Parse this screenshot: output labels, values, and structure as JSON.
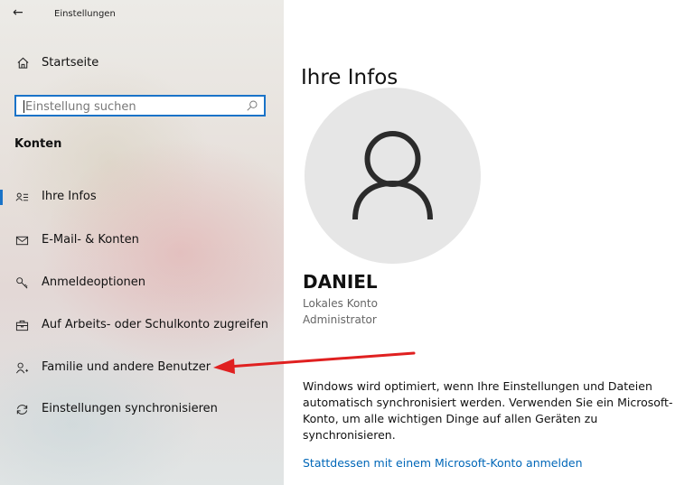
{
  "window": {
    "title": "Einstellungen"
  },
  "sidebar": {
    "home_label": "Startseite",
    "search": {
      "placeholder": "Einstellung suchen"
    },
    "section_title": "Konten",
    "items": [
      {
        "label": "Ihre Infos",
        "icon": "person-card-icon",
        "active": true
      },
      {
        "label": "E-Mail- & Konten",
        "icon": "mail-icon"
      },
      {
        "label": "Anmeldeoptionen",
        "icon": "key-icon"
      },
      {
        "label": "Auf Arbeits- oder Schulkonto zugreifen",
        "icon": "briefcase-icon"
      },
      {
        "label": "Familie und andere Benutzer",
        "icon": "person-add-icon"
      },
      {
        "label": "Einstellungen synchronisieren",
        "icon": "sync-icon"
      }
    ]
  },
  "main": {
    "title": "Ihre Infos",
    "user": {
      "name": "DANIEL",
      "account_type": "Lokales Konto",
      "role": "Administrator"
    },
    "info_text": "Windows wird optimiert, wenn Ihre Einstellungen und Dateien automatisch synchronisiert werden. Verwenden Sie ein Microsoft-Konto, um alle wichtigen Dinge auf allen Geräten zu synchronisieren.",
    "link": "Stattdessen mit einem Microsoft-Konto anmelden"
  },
  "colors": {
    "accent": "#1a73c8",
    "link": "#0067b8",
    "annotation_arrow": "#e02020"
  }
}
